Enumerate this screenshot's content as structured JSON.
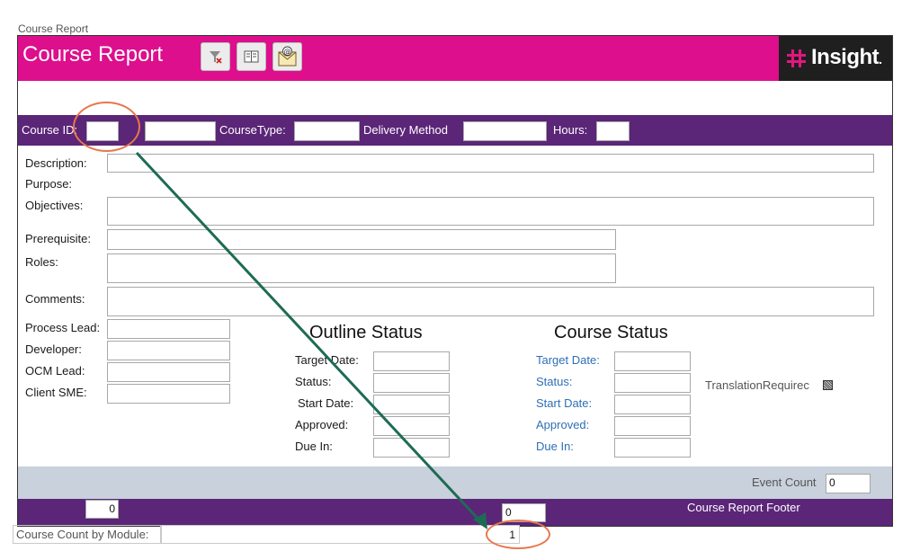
{
  "window": {
    "caption": "Course Report"
  },
  "header": {
    "title": "Course Report",
    "logo_text": "Insight",
    "logo_dot": ".",
    "buttons": [
      {
        "name": "remove-filter-button",
        "icon": "filter-remove-icon"
      },
      {
        "name": "report-view-button",
        "icon": "report-view-icon"
      },
      {
        "name": "email-button",
        "icon": "email-envelope-icon"
      }
    ]
  },
  "course_band": {
    "course_id_label": "Course ID:",
    "course_type_label": "CourseType:",
    "delivery_method_label": "Delivery Method",
    "hours_label": "Hours:"
  },
  "detail": {
    "description_label": "Description:",
    "purpose_label": "Purpose:",
    "objectives_label": "Objectives:",
    "prerequisite_label": "Prerequisite:",
    "roles_label": "Roles:",
    "comments_label": "Comments:",
    "process_lead_label": "Process Lead:",
    "developer_label": "Developer:",
    "ocm_lead_label": "OCM Lead:",
    "client_sme_label": "Client SME:"
  },
  "outline_status": {
    "heading": "Outline Status",
    "target_date_label": "Target Date:",
    "status_label": "Status:",
    "start_date_label": "Start Date:",
    "approved_label": "Approved:",
    "due_in_label": "Due In:"
  },
  "course_status": {
    "heading": "Course Status",
    "target_date_label": "Target Date:",
    "status_label": "Status:",
    "start_date_label": "Start Date:",
    "approved_label": "Approved:",
    "due_in_label": "Due In:"
  },
  "translation": {
    "label": "TranslationRequirec"
  },
  "counts": {
    "event_count_label": "Event Count",
    "event_count_value": "0"
  },
  "footer": {
    "left_value": "0",
    "mid_value": "0",
    "label": "Course Report  Footer"
  },
  "bottom": {
    "label": "Course Count by Module:",
    "value": "1"
  },
  "colors": {
    "header": "#dd0f8c",
    "band": "#5b2578",
    "count_band": "#c8d1dc",
    "annotation": "#e8774d",
    "arrow": "#1e6b55"
  }
}
